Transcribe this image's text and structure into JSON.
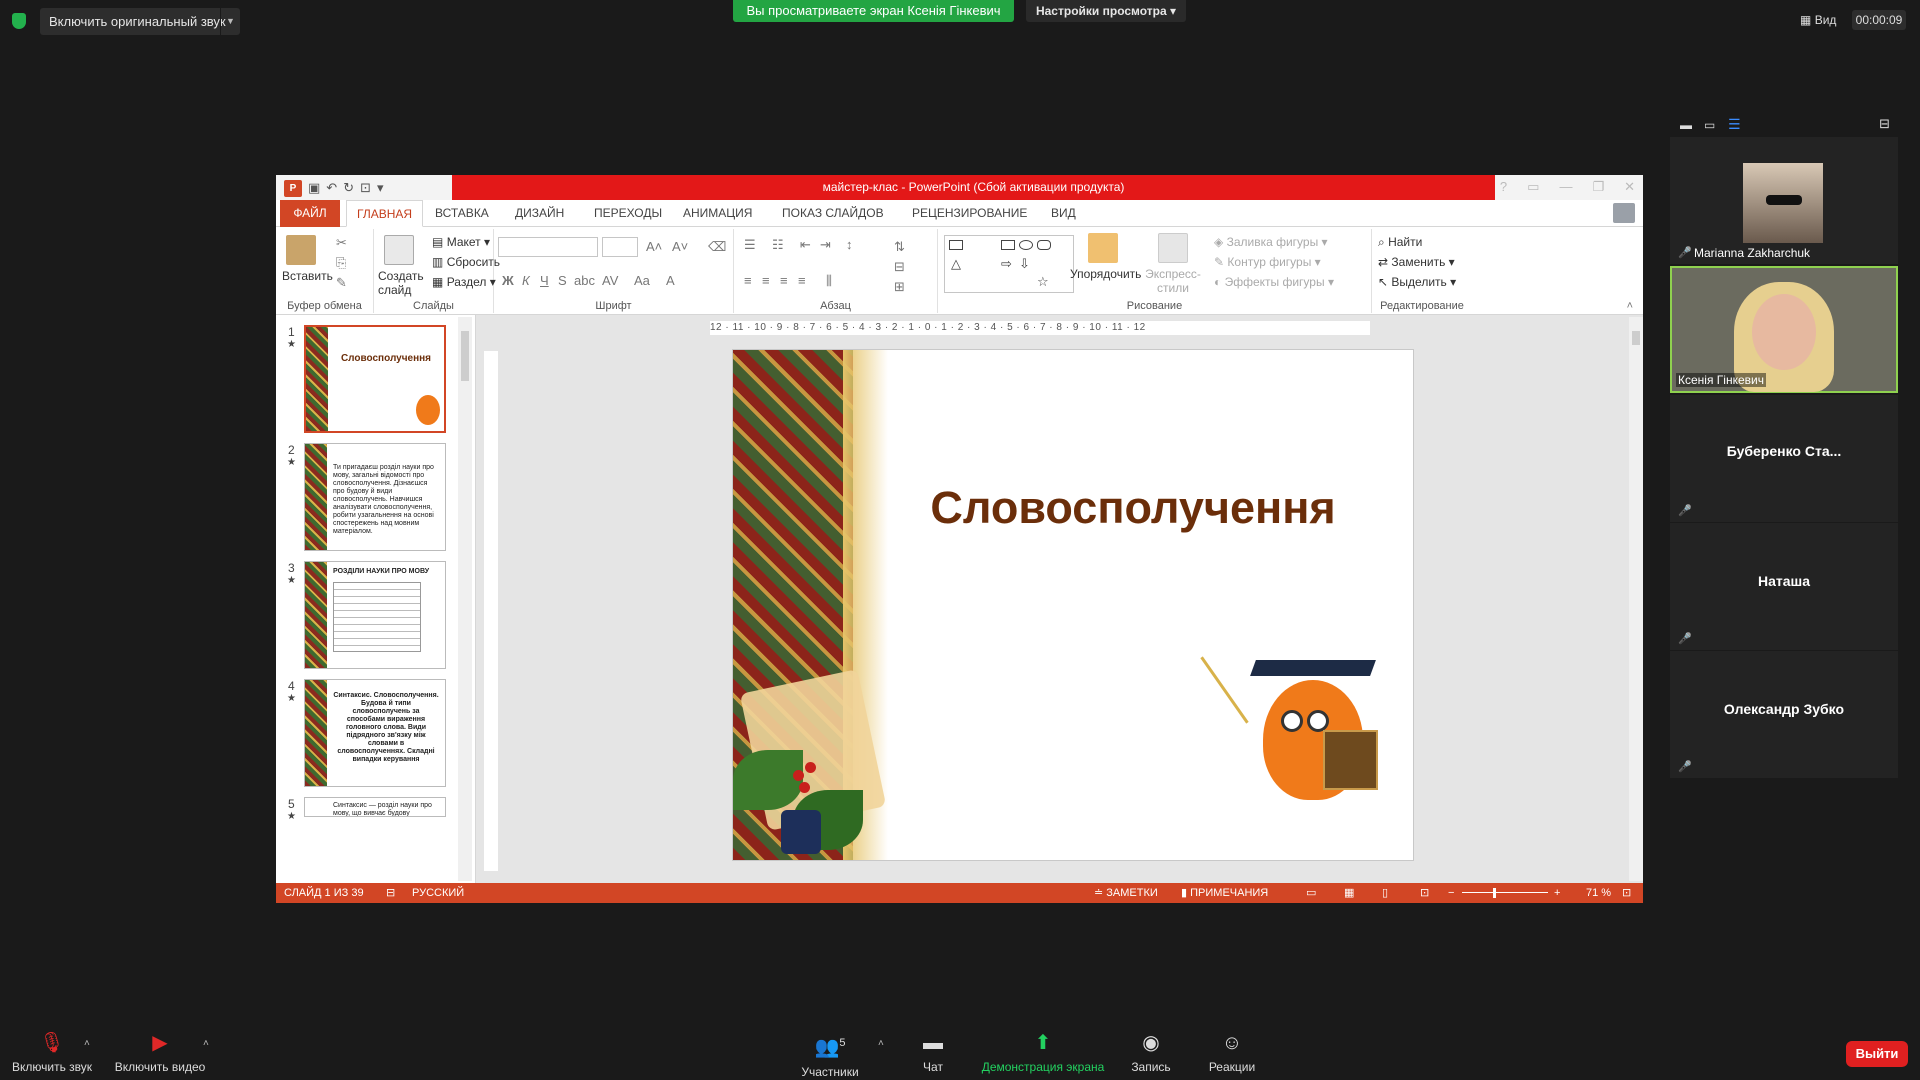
{
  "topbar": {
    "original_sound": "Включить оригинальный звук",
    "share_banner": "Вы просматриваете экран Ксенія Гінкевич",
    "view_settings": "Настройки просмотра",
    "view": "Вид",
    "timer": "00:00:09"
  },
  "ppt": {
    "window_title": "майстер-клас -  PowerPoint (Сбой активации продукта)",
    "tabs": [
      "ФАЙЛ",
      "ГЛАВНАЯ",
      "ВСТАВКА",
      "ДИЗАЙН",
      "ПЕРЕХОДЫ",
      "АНИМАЦИЯ",
      "ПОКАЗ СЛАЙДОВ",
      "РЕЦЕНЗИРОВАНИЕ",
      "ВИД"
    ],
    "ribbon": {
      "paste": "Вставить",
      "create_slide": "Создать слайд",
      "layout": "Макет",
      "reset": "Сбросить",
      "section": "Раздел",
      "arrange": "Упорядочить",
      "express_styles": "Экспресс-стили",
      "shape_fill": "Заливка фигуры",
      "shape_outline": "Контур фигуры",
      "shape_effects": "Эффекты фигуры",
      "find": "Найти",
      "replace": "Заменить",
      "select": "Выделить",
      "group_clipboard": "Буфер обмена",
      "group_slides": "Слайды",
      "group_font": "Шрифт",
      "group_paragraph": "Абзац",
      "group_drawing": "Рисование",
      "group_editing": "Редактирование"
    },
    "thumbs": [
      {
        "num": "1",
        "text": "Словосполучення"
      },
      {
        "num": "2",
        "text": "Ти пригадаєш розділ науки про мову, загальні відомості про словосполучення. Дізнаєшся про будову й види словосполучень. Навчишся аналізувати словосполучення, робити узагальнення на основі спостережень над мовним матеріалом."
      },
      {
        "num": "3",
        "text": "РОЗДІЛИ НАУКИ ПРО МОВУ"
      },
      {
        "num": "4",
        "text": "Синтаксис. Словосполучення. Будова й типи словосполучень за способами вираження головного слова. Види підрядного зв'язку між словами в словосполученнях. Складні випадки керування"
      },
      {
        "num": "5",
        "text": "Синтаксис — розділ науки про мову, що вивчає будову"
      }
    ],
    "ruler": "12 · 11 · 10 · 9 · 8 · 7 · 6 · 5 · 4 · 3 · 2 · 1 · 0 · 1 · 2 · 3 · 4 · 5 · 6 · 7 · 8 · 9 · 10 · 11 · 12",
    "slide_title": "Словосполучення",
    "status": {
      "slide": "СЛАЙД 1 ИЗ 39",
      "language": "РУССКИЙ",
      "notes": "ЗАМЕТКИ",
      "comments": "ПРИМЕЧАНИЯ",
      "zoom": "71 %"
    }
  },
  "gallery": {
    "participants": [
      {
        "name": "Marianna Zakharchuk",
        "type": "photo"
      },
      {
        "name": "Ксенія Гінкевич",
        "type": "video"
      },
      {
        "name": "Буберенко  Ста...",
        "type": "name"
      },
      {
        "name": "Наташа",
        "type": "name"
      },
      {
        "name": "Олександр Зубко",
        "type": "name"
      }
    ]
  },
  "bottombar": {
    "audio": "Включить звук",
    "video": "Включить видео",
    "participants": "Участники",
    "participants_count": "5",
    "chat": "Чат",
    "share": "Демонстрация экрана",
    "record": "Запись",
    "reactions": "Реакции",
    "leave": "Выйти"
  },
  "colors": {
    "ppt_accent": "#d24625",
    "title_red": "#e31818",
    "share_green": "#23a543",
    "leave_red": "#e02020"
  }
}
